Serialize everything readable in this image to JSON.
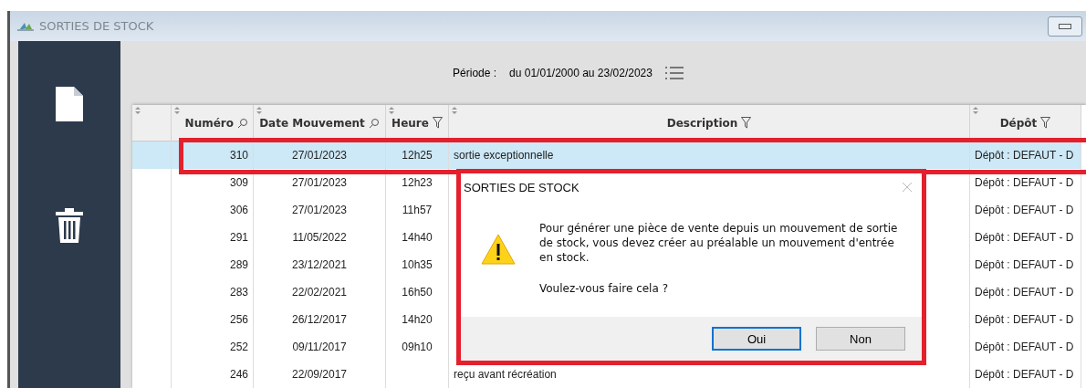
{
  "window": {
    "title": "SORTIES DE STOCK"
  },
  "sidebar": {
    "items": [
      {
        "kind": "new"
      },
      {
        "kind": "delete"
      }
    ]
  },
  "period": {
    "label": "Période :",
    "value": "du 01/01/2000 au 23/02/2023"
  },
  "table": {
    "columns": [
      {
        "label": "Numéro",
        "kind": "search"
      },
      {
        "label": "Date Mouvement",
        "kind": "search"
      },
      {
        "label": "Heure",
        "kind": "filter"
      },
      {
        "label": "Description",
        "kind": "filter"
      },
      {
        "label": "Dépôt",
        "kind": "filter"
      }
    ],
    "rows": [
      {
        "selected": true,
        "cells": [
          "310",
          "27/01/2023",
          "12h25",
          "sortie exceptionnelle",
          "Dépôt : DEFAUT - D"
        ]
      },
      {
        "selected": false,
        "cells": [
          "309",
          "27/01/2023",
          "12h23",
          "",
          "Dépôt : DEFAUT - D"
        ]
      },
      {
        "selected": false,
        "cells": [
          "306",
          "27/01/2023",
          "11h57",
          "",
          "Dépôt : DEFAUT - D"
        ]
      },
      {
        "selected": false,
        "cells": [
          "291",
          "11/05/2022",
          "14h40",
          "",
          "Dépôt : DEFAUT - D"
        ]
      },
      {
        "selected": false,
        "cells": [
          "289",
          "23/12/2021",
          "10h35",
          "",
          "Dépôt : DEFAUT - D"
        ]
      },
      {
        "selected": false,
        "cells": [
          "283",
          "22/02/2021",
          "16h50",
          "",
          "Dépôt : DEFAUT - D"
        ]
      },
      {
        "selected": false,
        "cells": [
          "256",
          "26/12/2017",
          "14h20",
          "",
          "Dépôt : DEFAUT - D"
        ]
      },
      {
        "selected": false,
        "cells": [
          "252",
          "09/11/2017",
          "09h10",
          "",
          "Dépôt : DEFAUT - D"
        ]
      },
      {
        "selected": false,
        "cells": [
          "246",
          "22/09/2017",
          "",
          "reçu avant récréation",
          "Dépôt : DEFAUT - D"
        ]
      }
    ]
  },
  "dialog": {
    "title": "SORTIES DE STOCK",
    "message": "Pour générer une pièce de vente depuis un mouvement de sortie de stock, vous devez créer au préalable un mouvement d'entrée en stock.",
    "question": "Voulez-vous faire cela ?",
    "buttons": [
      {
        "label": "Oui",
        "default": true
      },
      {
        "label": "Non",
        "default": false
      }
    ]
  }
}
